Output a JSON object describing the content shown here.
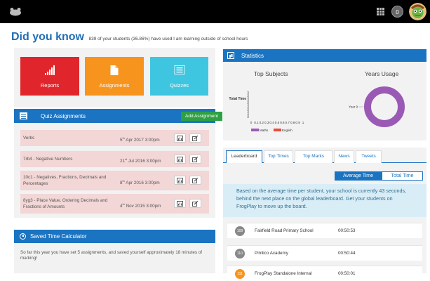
{
  "header": {
    "notification_count": "0"
  },
  "did_you_know": {
    "heading": "Did you know",
    "text": "839 of your students (36.86%) have used I am learning outside of school hours"
  },
  "tiles": [
    {
      "label": "Reports",
      "icon": "bar-chart-icon",
      "color": "#e0262c"
    },
    {
      "label": "Assignments",
      "icon": "document-icon",
      "color": "#f7941d"
    },
    {
      "label": "Quizzes",
      "icon": "list-icon",
      "color": "#3ec6e0"
    }
  ],
  "quiz_assignments": {
    "title": "Quiz Assignments",
    "add_button": "Add Assignment",
    "rows": [
      {
        "name": "Verbs",
        "day": "5",
        "suffix": "th",
        "rest": "Apr 2017 3:00pm"
      },
      {
        "name": "7rb4 - Negative Numbers",
        "day": "21",
        "suffix": "st",
        "rest": "Jul 2016 3:00pm"
      },
      {
        "name": "10c1 - Negatives, Fractions, Decimals and Percentages",
        "day": "8",
        "suffix": "th",
        "rest": "Apr 2016 3:00pm"
      },
      {
        "name": "8yg3 - Place Value, Ordering Decimals and Fractions of Amounts",
        "day": "4",
        "suffix": "th",
        "rest": "Nov 2015 3:00pm"
      }
    ]
  },
  "saved_time": {
    "title": "Saved Time Calculator",
    "text": "So far this year you have set 5 assignments, and saved yourself approximately 18 minutes of marking!"
  },
  "statistics": {
    "title": "Statistics",
    "subjects_title": "Top Subjects",
    "years_title": "Years Usage"
  },
  "chart_data": [
    {
      "type": "bar",
      "title": "Top Subjects",
      "categories": [
        "Total Time"
      ],
      "x_ticks": [
        "0",
        "0.1",
        "0.2",
        "0.3",
        "0.4",
        "0.5",
        "0.6",
        "0.7",
        "0.8",
        "0.9",
        "1"
      ],
      "xlim": [
        0,
        1
      ],
      "series": [
        {
          "name": "Maths",
          "color": "#9b59b6"
        },
        {
          "name": "English",
          "color": "#e74c3c"
        }
      ],
      "legend": "bottom"
    },
    {
      "type": "pie",
      "title": "Years Usage",
      "labels": [
        "Year 9"
      ],
      "values": [
        100
      ],
      "colors": [
        "#9b59b6"
      ]
    }
  ],
  "leaderboard": {
    "tabs": [
      "Leaderboard",
      "Top Times",
      "Top Marks",
      "News",
      "Tweets"
    ],
    "segments": [
      "Average Time",
      "Total Time"
    ],
    "info": "Based on the average time per student, your school is currently 43 seconds, behind the next place on the global leaderboard. Get your students on FrogPlay to move up the board.",
    "rows": [
      {
        "pos": "109",
        "school": "Fairfield Road Primary School",
        "time": "00:50:53",
        "color": "#888888"
      },
      {
        "pos": "110",
        "school": "Pimlico Academy",
        "time": "00:50:44",
        "color": "#888888"
      },
      {
        "pos": "111",
        "school": "FrogPlay Standalone Internal",
        "time": "00:50:01",
        "color": "#f7941d"
      }
    ]
  }
}
